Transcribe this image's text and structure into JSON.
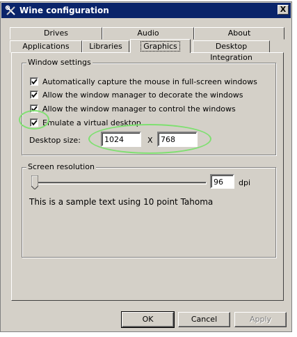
{
  "window": {
    "title": "Wine configuration",
    "close_glyph": "X"
  },
  "tabs": {
    "row1": [
      "Drives",
      "Audio",
      "About"
    ],
    "row2": [
      "Applications",
      "Libraries",
      "Graphics",
      "Desktop Integration"
    ],
    "active": "Graphics"
  },
  "window_settings": {
    "group_label": "Window settings",
    "options": [
      {
        "label": "Automatically capture the mouse in full-screen windows",
        "checked": true
      },
      {
        "label": "Allow the window manager to decorate the windows",
        "checked": true
      },
      {
        "label": "Allow the window manager to control the windows",
        "checked": true
      },
      {
        "label": "Emulate a virtual desktop",
        "checked": true
      }
    ],
    "desktop_size_label": "Desktop size:",
    "width_value": "1024",
    "separator": "X",
    "height_value": "768"
  },
  "screen_resolution": {
    "group_label": "Screen resolution",
    "dpi_value": "96",
    "dpi_unit": "dpi",
    "sample_text": "This is a sample text using 10 point Tahoma"
  },
  "buttons": {
    "ok": "OK",
    "cancel": "Cancel",
    "apply": "Apply"
  },
  "colors": {
    "titlebar": "#0a246a",
    "face": "#d4d0c8",
    "highlight_annotation": "#7ee070"
  }
}
